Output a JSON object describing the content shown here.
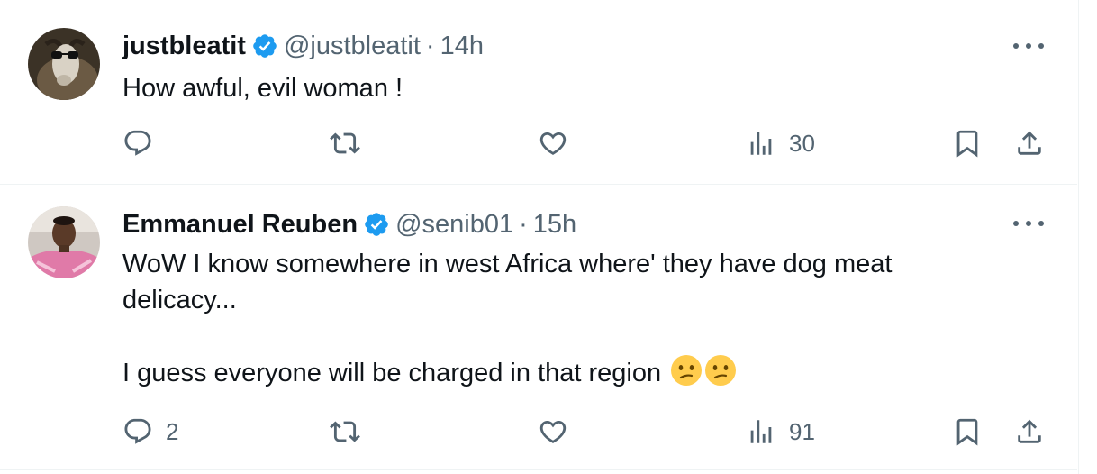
{
  "tweets": [
    {
      "display_name": "justbleatit",
      "handle": "@justbleatit",
      "separator": "·",
      "time": "14h",
      "avatar_icon": "goat-with-sunglasses-avatar",
      "verified": true,
      "text": "How awful, evil woman !",
      "replies": "",
      "retweets": "",
      "likes": "",
      "views": "30"
    },
    {
      "display_name": "Emmanuel Reuben",
      "handle": "@senib01",
      "separator": "·",
      "time": "15h",
      "avatar_icon": "person-avatar",
      "verified": true,
      "text": "WoW I know somewhere in west Africa where' they have dog meat\ndelicacy...\n\nI guess everyone will be charged in that region",
      "emoji": [
        "confused-face-emoji",
        "confused-face-emoji"
      ],
      "replies": "2",
      "retweets": "",
      "likes": "",
      "views": "91"
    }
  ],
  "colors": {
    "text_primary": "#0f1419",
    "text_secondary": "#536471",
    "verified_blue": "#1d9bf0",
    "divider": "#eff3f4"
  }
}
